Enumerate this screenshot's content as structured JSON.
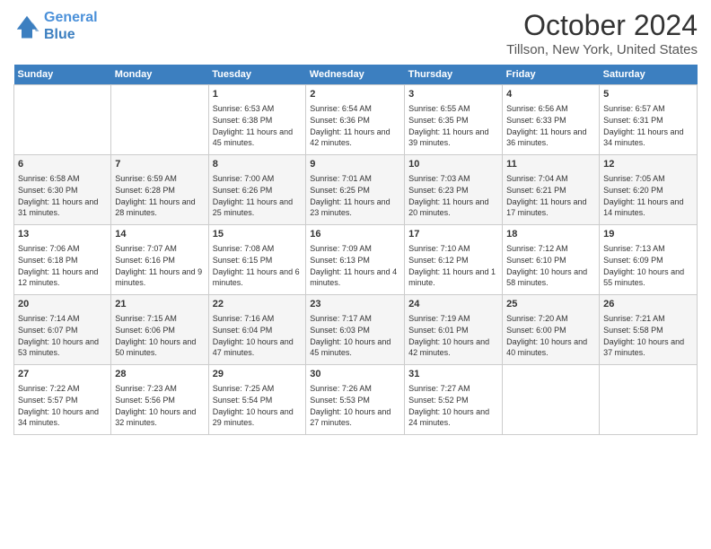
{
  "header": {
    "logo_line1": "General",
    "logo_line2": "Blue",
    "month_year": "October 2024",
    "location": "Tillson, New York, United States"
  },
  "days_of_week": [
    "Sunday",
    "Monday",
    "Tuesday",
    "Wednesday",
    "Thursday",
    "Friday",
    "Saturday"
  ],
  "weeks": [
    [
      {
        "day": "",
        "info": ""
      },
      {
        "day": "",
        "info": ""
      },
      {
        "day": "1",
        "info": "Sunrise: 6:53 AM\nSunset: 6:38 PM\nDaylight: 11 hours and 45 minutes."
      },
      {
        "day": "2",
        "info": "Sunrise: 6:54 AM\nSunset: 6:36 PM\nDaylight: 11 hours and 42 minutes."
      },
      {
        "day": "3",
        "info": "Sunrise: 6:55 AM\nSunset: 6:35 PM\nDaylight: 11 hours and 39 minutes."
      },
      {
        "day": "4",
        "info": "Sunrise: 6:56 AM\nSunset: 6:33 PM\nDaylight: 11 hours and 36 minutes."
      },
      {
        "day": "5",
        "info": "Sunrise: 6:57 AM\nSunset: 6:31 PM\nDaylight: 11 hours and 34 minutes."
      }
    ],
    [
      {
        "day": "6",
        "info": "Sunrise: 6:58 AM\nSunset: 6:30 PM\nDaylight: 11 hours and 31 minutes."
      },
      {
        "day": "7",
        "info": "Sunrise: 6:59 AM\nSunset: 6:28 PM\nDaylight: 11 hours and 28 minutes."
      },
      {
        "day": "8",
        "info": "Sunrise: 7:00 AM\nSunset: 6:26 PM\nDaylight: 11 hours and 25 minutes."
      },
      {
        "day": "9",
        "info": "Sunrise: 7:01 AM\nSunset: 6:25 PM\nDaylight: 11 hours and 23 minutes."
      },
      {
        "day": "10",
        "info": "Sunrise: 7:03 AM\nSunset: 6:23 PM\nDaylight: 11 hours and 20 minutes."
      },
      {
        "day": "11",
        "info": "Sunrise: 7:04 AM\nSunset: 6:21 PM\nDaylight: 11 hours and 17 minutes."
      },
      {
        "day": "12",
        "info": "Sunrise: 7:05 AM\nSunset: 6:20 PM\nDaylight: 11 hours and 14 minutes."
      }
    ],
    [
      {
        "day": "13",
        "info": "Sunrise: 7:06 AM\nSunset: 6:18 PM\nDaylight: 11 hours and 12 minutes."
      },
      {
        "day": "14",
        "info": "Sunrise: 7:07 AM\nSunset: 6:16 PM\nDaylight: 11 hours and 9 minutes."
      },
      {
        "day": "15",
        "info": "Sunrise: 7:08 AM\nSunset: 6:15 PM\nDaylight: 11 hours and 6 minutes."
      },
      {
        "day": "16",
        "info": "Sunrise: 7:09 AM\nSunset: 6:13 PM\nDaylight: 11 hours and 4 minutes."
      },
      {
        "day": "17",
        "info": "Sunrise: 7:10 AM\nSunset: 6:12 PM\nDaylight: 11 hours and 1 minute."
      },
      {
        "day": "18",
        "info": "Sunrise: 7:12 AM\nSunset: 6:10 PM\nDaylight: 10 hours and 58 minutes."
      },
      {
        "day": "19",
        "info": "Sunrise: 7:13 AM\nSunset: 6:09 PM\nDaylight: 10 hours and 55 minutes."
      }
    ],
    [
      {
        "day": "20",
        "info": "Sunrise: 7:14 AM\nSunset: 6:07 PM\nDaylight: 10 hours and 53 minutes."
      },
      {
        "day": "21",
        "info": "Sunrise: 7:15 AM\nSunset: 6:06 PM\nDaylight: 10 hours and 50 minutes."
      },
      {
        "day": "22",
        "info": "Sunrise: 7:16 AM\nSunset: 6:04 PM\nDaylight: 10 hours and 47 minutes."
      },
      {
        "day": "23",
        "info": "Sunrise: 7:17 AM\nSunset: 6:03 PM\nDaylight: 10 hours and 45 minutes."
      },
      {
        "day": "24",
        "info": "Sunrise: 7:19 AM\nSunset: 6:01 PM\nDaylight: 10 hours and 42 minutes."
      },
      {
        "day": "25",
        "info": "Sunrise: 7:20 AM\nSunset: 6:00 PM\nDaylight: 10 hours and 40 minutes."
      },
      {
        "day": "26",
        "info": "Sunrise: 7:21 AM\nSunset: 5:58 PM\nDaylight: 10 hours and 37 minutes."
      }
    ],
    [
      {
        "day": "27",
        "info": "Sunrise: 7:22 AM\nSunset: 5:57 PM\nDaylight: 10 hours and 34 minutes."
      },
      {
        "day": "28",
        "info": "Sunrise: 7:23 AM\nSunset: 5:56 PM\nDaylight: 10 hours and 32 minutes."
      },
      {
        "day": "29",
        "info": "Sunrise: 7:25 AM\nSunset: 5:54 PM\nDaylight: 10 hours and 29 minutes."
      },
      {
        "day": "30",
        "info": "Sunrise: 7:26 AM\nSunset: 5:53 PM\nDaylight: 10 hours and 27 minutes."
      },
      {
        "day": "31",
        "info": "Sunrise: 7:27 AM\nSunset: 5:52 PM\nDaylight: 10 hours and 24 minutes."
      },
      {
        "day": "",
        "info": ""
      },
      {
        "day": "",
        "info": ""
      }
    ]
  ]
}
